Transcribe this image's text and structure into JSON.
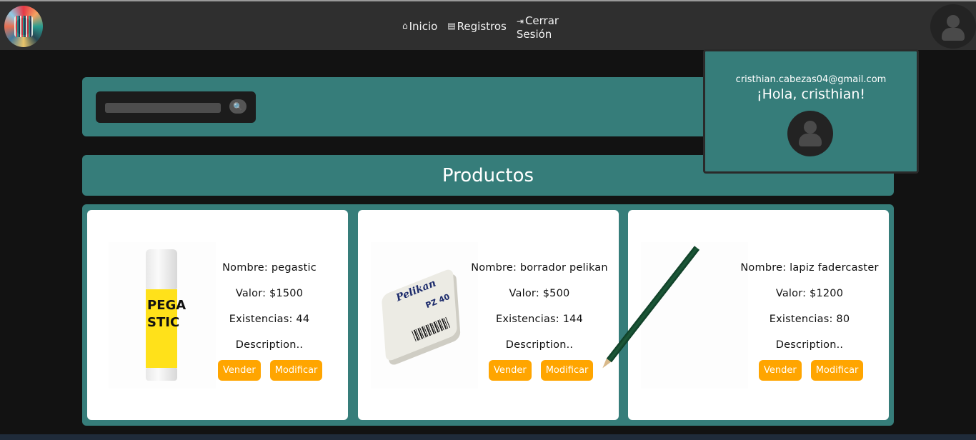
{
  "nav": {
    "items": [
      {
        "icon": "home-icon",
        "label": "Inicio"
      },
      {
        "icon": "register-icon",
        "label": "Registros"
      }
    ],
    "logout": {
      "icon": "logout-icon",
      "line1": "Cerrar",
      "line2": "Sesión"
    }
  },
  "search": {
    "placeholder": "",
    "button_icon": "search-icon"
  },
  "profile": {
    "email": "cristhian.cabezas04@gmail.com",
    "greeting": "¡Hola, cristhian!"
  },
  "products": {
    "title": "Productos",
    "items": [
      {
        "nombre": "Nombre: pegastic",
        "valor": "Valor: $1500",
        "existencias": "Existencias: 44",
        "descripcion": "Description..",
        "sell": "Vender",
        "edit": "Modificar",
        "image_text_1": "PEGA",
        "image_text_2": "STIC"
      },
      {
        "nombre": "Nombre: borrador pelikan",
        "valor": "Valor: $500",
        "existencias": "Existencias: 144",
        "descripcion": "Description..",
        "sell": "Vender",
        "edit": "Modificar",
        "image_text_1": "Pelikan",
        "image_text_2": "PZ 40"
      },
      {
        "nombre": "Nombre: lapiz fadercaster",
        "valor": "Valor: $1200",
        "existencias": "Existencias: 80",
        "descripcion": "Description..",
        "sell": "Vender",
        "edit": "Modificar"
      }
    ]
  },
  "colors": {
    "panel": "#367d7a",
    "accent": "#ffa500",
    "background": "#121212",
    "topbar": "#2f2f2f"
  }
}
